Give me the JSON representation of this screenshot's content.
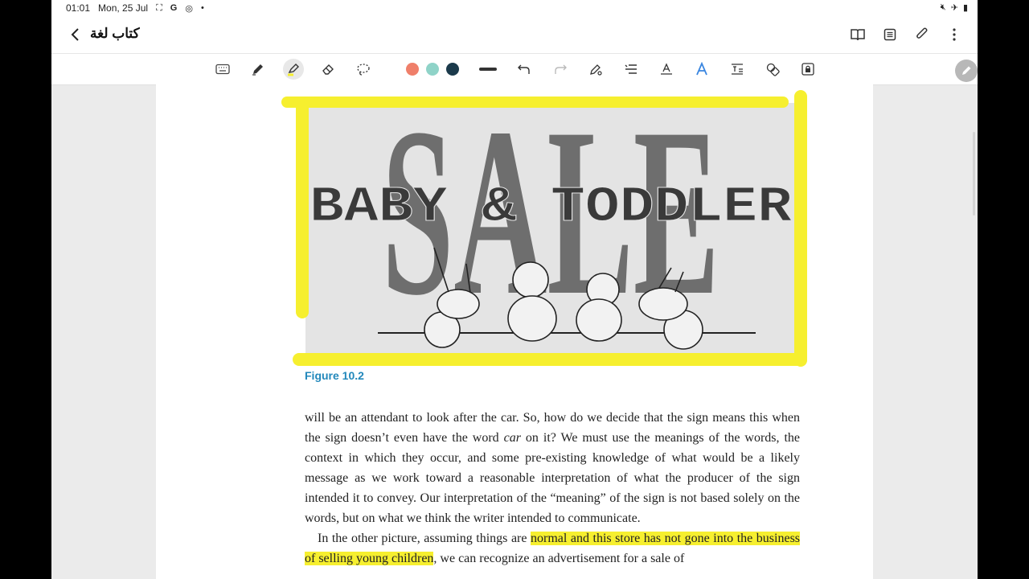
{
  "status_bar": {
    "time": "01:01",
    "date": "Mon, 25 Jul",
    "left_icons": [
      "screenshot-icon",
      "google-icon",
      "instagram-icon",
      "dot-icon"
    ],
    "right_icons": [
      "mute-icon",
      "airplane-icon",
      "battery-icon"
    ]
  },
  "title_bar": {
    "title": "كتاب لغة",
    "actions": [
      "book-view-icon",
      "page-list-icon",
      "attach-icon",
      "more-icon"
    ]
  },
  "toolbar": {
    "tools": [
      "keyboard-icon",
      "pen-icon",
      "highlighter-icon",
      "eraser-icon",
      "lasso-icon"
    ],
    "active_tool": "highlighter-icon",
    "colors": [
      "#ef7f6a",
      "#8fd3c8",
      "#1b3a4b"
    ],
    "more_tools": [
      "line-width-icon",
      "undo-icon",
      "redo-icon",
      "pen-settings-icon",
      "text-align-icon",
      "text-style-icon",
      "font-icon",
      "text-box-icon",
      "shapes-icon",
      "lock-icon"
    ]
  },
  "figure": {
    "caption": "Figure 10.2",
    "sign_line1": "SALE",
    "sign_line2": "BABY & TODDLER"
  },
  "body": {
    "paragraph1": "will be an attendant to look after the car. So, how do we decide that the sign means this when the sign doesn’t even have the word",
    "paragraph1_italic": "car",
    "paragraph1_rest": "on it? We must use the meanings of the words, the context in which they occur, and some pre-existing knowledge of what would be a likely message as we work toward a reasonable interpretation of what the producer of the sign intended it to convey. Our interpretation of the “meaning” of the sign is not based solely on the words, but on what we think the writer intended to communicate.",
    "paragraph2_start": "In the other picture, assuming things are",
    "paragraph2_highlight": "normal and this store has not gone into the business of selling young children",
    "paragraph2_rest": ", we can recognize an advertisement for a sale of"
  },
  "colors": {
    "highlight": "#f6ef2f",
    "caption": "#2288bb"
  }
}
